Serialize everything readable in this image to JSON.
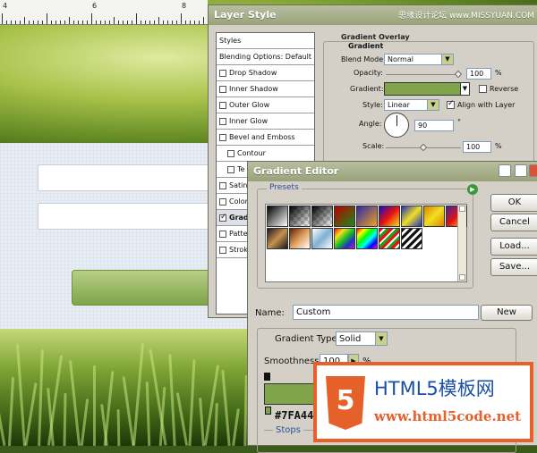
{
  "watermark_top": "思缘设计论坛 www.MISSYUAN.COM",
  "ruler": {
    "numbers": [
      "4",
      "6",
      "8"
    ]
  },
  "layer_style": {
    "title": "Layer Style",
    "list": [
      {
        "label": "Styles",
        "checkbox": false,
        "checked": false
      },
      {
        "label": "Blending Options: Default",
        "checkbox": false,
        "checked": false
      },
      {
        "label": "Drop Shadow",
        "checkbox": true,
        "checked": false
      },
      {
        "label": "Inner Shadow",
        "checkbox": true,
        "checked": false
      },
      {
        "label": "Outer Glow",
        "checkbox": true,
        "checked": false
      },
      {
        "label": "Inner Glow",
        "checkbox": true,
        "checked": false
      },
      {
        "label": "Bevel and Emboss",
        "checkbox": true,
        "checked": false
      },
      {
        "label": "Contour",
        "checkbox": true,
        "checked": false
      },
      {
        "label": "Te",
        "checkbox": true,
        "checked": false
      },
      {
        "label": "Satin",
        "checkbox": true,
        "checked": false
      },
      {
        "label": "Color",
        "checkbox": true,
        "checked": false
      },
      {
        "label": "Grad",
        "checkbox": true,
        "checked": true
      },
      {
        "label": "Patte",
        "checkbox": true,
        "checked": false
      },
      {
        "label": "Stroke",
        "checkbox": true,
        "checked": false
      }
    ],
    "group_title": "Gradient Overlay",
    "sub_title": "Gradient",
    "blend_mode_label": "Blend Mode:",
    "blend_mode_value": "Normal",
    "opacity_label": "Opacity:",
    "opacity_value": "100",
    "opacity_level": 1.0,
    "percent": "%",
    "gradient_label": "Gradient:",
    "reverse_label": "Reverse",
    "style_label": "Style:",
    "style_value": "Linear",
    "align_label": "Align with Layer",
    "angle_label": "Angle:",
    "angle_value": "90",
    "degree": "°",
    "scale_label": "Scale:",
    "scale_value": "100",
    "scale_level": 0.5
  },
  "gradient_editor": {
    "title": "Gradient Editor",
    "presets_label": "Presets",
    "ok": "OK",
    "cancel": "Cancel",
    "load": "Load...",
    "save": "Save...",
    "name_label": "Name:",
    "name_value": "Custom",
    "new_label": "New",
    "type_label": "Gradient Type:",
    "type_value": "Solid",
    "smoothness_label": "Smoothness:",
    "smoothness_value": "100",
    "smoothness_unit": "%",
    "color_code": "#7FA44",
    "stops_label": "Stops",
    "gradient_color": "#7fa44a"
  },
  "brand_watermark": {
    "shield": "5",
    "line1": "HTML5模板网",
    "line2": "www.html5code.net"
  }
}
